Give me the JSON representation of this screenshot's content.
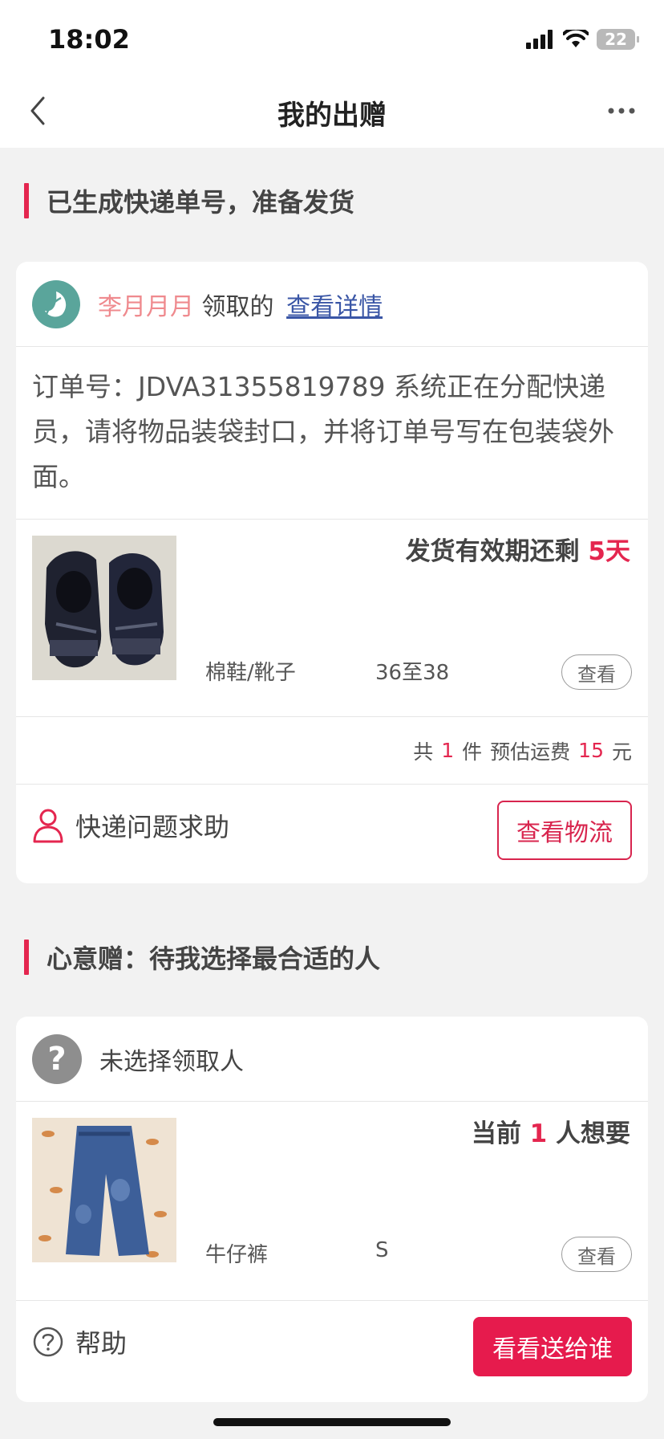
{
  "status_bar": {
    "time": "18:02",
    "battery": "22"
  },
  "nav": {
    "title": "我的出赠",
    "back_icon": "back-chevron-icon",
    "more_icon": "more-dots-icon"
  },
  "sections": [
    {
      "title": "已生成快递单号，准备发货"
    },
    {
      "title": "心意赠：待我选择最合适的人"
    }
  ],
  "card1": {
    "receiver_name": "李月月月",
    "receiver_suffix": "领取的",
    "detail_link": "查看详情",
    "order_message": "订单号：JDVA31355819789 系统正在分配快递员，请将物品装袋封口，并将订单号写在包装袋外面。",
    "deadline_prefix": "发货有效期还剩",
    "deadline_value": "5天",
    "item_category": "棉鞋/靴子",
    "item_size": "36至38",
    "view_label": "查看",
    "summary_prefix": "共",
    "summary_count": "1",
    "summary_unit": "件",
    "summary_fee_label": "预估运费",
    "summary_fee": "15",
    "summary_currency": "元",
    "help_label": "快递问题求助",
    "action_label": "查看物流"
  },
  "card2": {
    "receiver_placeholder": "未选择领取人",
    "want_prefix": "当前",
    "want_count": "1",
    "want_suffix": "人想要",
    "item_category": "牛仔裤",
    "item_size": "S",
    "view_label": "查看",
    "help_label": "帮助",
    "action_label": "看看送给谁"
  },
  "colors": {
    "accent": "#e4264f",
    "link": "#3a56a6",
    "name_pink": "#ef8a8e"
  }
}
